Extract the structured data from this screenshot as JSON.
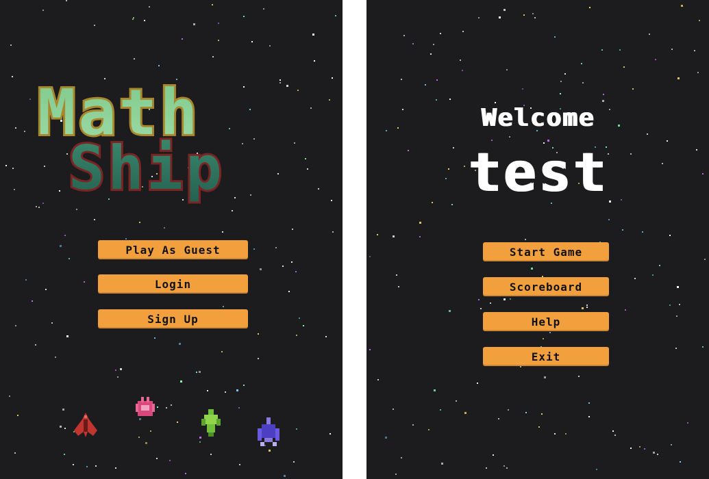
{
  "left_screen": {
    "logo": {
      "line1": "Math",
      "line2": "Ship"
    },
    "buttons": {
      "play_guest": "Play As Guest",
      "login": "Login",
      "sign_up": "Sign Up"
    },
    "ships": [
      "red-ship-icon",
      "pink-ship-icon",
      "green-ship-icon",
      "blue-ship-icon"
    ]
  },
  "right_screen": {
    "welcome": "Welcome",
    "username": "test",
    "buttons": {
      "start_game": "Start Game",
      "scoreboard": "Scoreboard",
      "help": "Help",
      "exit": "Exit"
    }
  },
  "colors": {
    "background": "#1c1c1e",
    "button": "#f2a03d",
    "logo_top": "#8fd49a",
    "logo_bottom": "#2f7a63",
    "logo_outline_top": "#b38a2a",
    "logo_outline_bottom": "#7a2020"
  }
}
